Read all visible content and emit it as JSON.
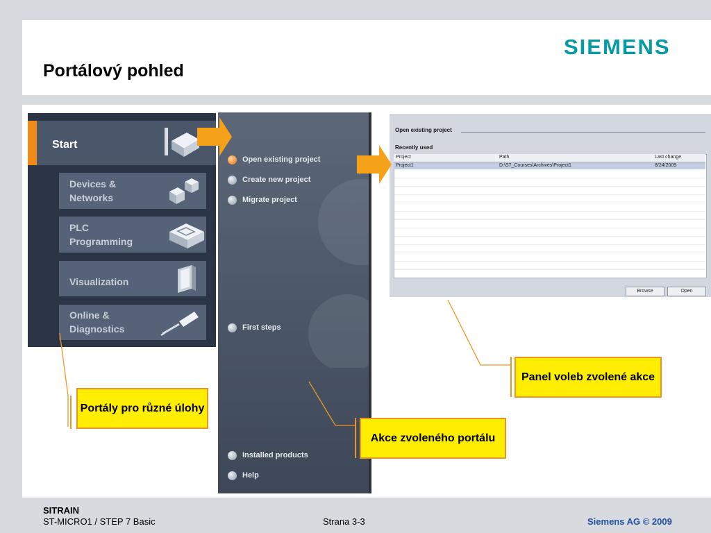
{
  "slide": {
    "title": "Portálový pohled",
    "logo": "SIEMENS",
    "footer": {
      "org": "SITRAIN",
      "course": "ST-MICRO1 / STEP 7 Basic",
      "page": "Strana 3-3",
      "copyright": "Siemens AG © 2009"
    }
  },
  "portals": {
    "start": "Start",
    "items": [
      {
        "label": "Devices &\nNetworks",
        "icon": "devices-networks-icon"
      },
      {
        "label": "PLC\nProgramming",
        "icon": "plc-programming-icon"
      },
      {
        "label": "Visualization",
        "icon": "visualization-icon"
      },
      {
        "label": "Online &\nDiagnostics",
        "icon": "online-diagnostics-icon"
      }
    ]
  },
  "actions": {
    "items": [
      "Open existing project",
      "Create new project",
      "Migrate project"
    ],
    "first_steps": "First steps",
    "bottom": [
      "Installed products",
      "Help"
    ]
  },
  "options_panel": {
    "heading": "Open existing project",
    "recent": "Recently used",
    "columns": [
      "Project",
      "Path",
      "Last change"
    ],
    "rows": [
      [
        "Project1",
        "D:\\S7_Courses\\Archives\\Project1",
        "8/24/2009"
      ]
    ],
    "buttons": [
      "Browse",
      "Open"
    ]
  },
  "callouts": {
    "portals": "Portály pro různé úlohy",
    "actions": "Akce zvoleného portálu",
    "panel": "Panel voleb zvolené akce"
  },
  "colors": {
    "accent": "#f08a16",
    "brand": "#079aa5",
    "callout": "#ffee00"
  }
}
